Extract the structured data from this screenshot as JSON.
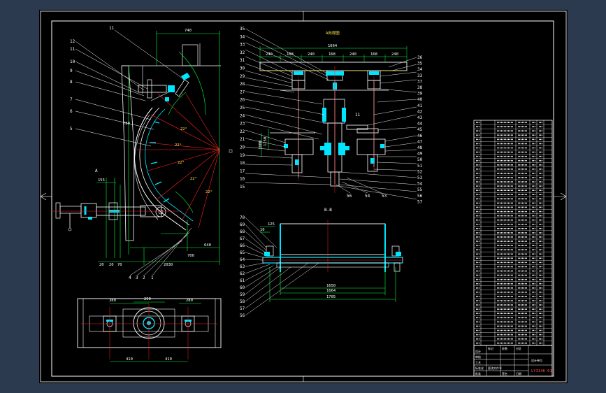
{
  "colors": {
    "background": "#2b3a4e",
    "sheet": "#000000",
    "outline": "#ffffff",
    "dimension": "#00ff3c",
    "part": "#00e5ff",
    "section": "#ff2020",
    "hidden": "#ffe34d"
  },
  "views": {
    "arc_view": {
      "section_mark": "A",
      "left_labels": [
        "11",
        "12",
        "11",
        "10",
        "9",
        "8",
        "7",
        "6",
        "5"
      ],
      "bottom_labels": [
        "4",
        "3",
        "2",
        "1"
      ],
      "dims": {
        "top_width": "740",
        "side_height": "780",
        "left_offset": "155",
        "lower_width": "640",
        "bottom_total": "2030",
        "bottom_small_a": "20",
        "bottom_small_b": "20",
        "bottom_small_c": "70",
        "right_height": "700"
      },
      "angles": [
        "22°",
        "22°",
        "22°",
        "22°",
        "22°"
      ]
    },
    "section_a": {
      "title": "A向视图",
      "top_dim": "1664",
      "segment_dims": [
        "240",
        "168",
        "240",
        "168",
        "240",
        "168",
        "240"
      ],
      "left_labels": [
        "35",
        "34",
        "33",
        "32",
        "31",
        "30",
        "29",
        "28",
        "27",
        "26",
        "25",
        "24",
        "23",
        "22",
        "21",
        "20",
        "19",
        "18",
        "17",
        "16",
        "15"
      ],
      "right_labels": [
        "36",
        "35",
        "34",
        "33",
        "37",
        "38",
        "39",
        "40",
        "41",
        "42",
        "43",
        "44",
        "45",
        "46",
        "47",
        "48",
        "49",
        "50",
        "51",
        "52",
        "53",
        "54",
        "55",
        "56",
        "57"
      ],
      "bottom_labels": [
        "56",
        "54",
        "53"
      ],
      "center_label": "11",
      "side_dim": "1000",
      "side_dim_b": "1150"
    },
    "section_b": {
      "title": "B-B",
      "left_labels": [
        "70",
        "69",
        "68",
        "67",
        "66",
        "65",
        "64",
        "63",
        "62",
        "61",
        "60",
        "59",
        "58",
        "57",
        "56"
      ],
      "dims": {
        "inner": "1650",
        "mid": "1664",
        "outer": "1705",
        "left_a": "125",
        "left_b": "10"
      }
    },
    "plan_view": {
      "dims": {
        "left": "380",
        "center": "290",
        "right": "280",
        "bottom_left": "410",
        "bottom_right": "410"
      }
    }
  },
  "title_block": {
    "drawing_number": "LY3146-01",
    "company": "设计单位",
    "rows": [
      "设计",
      "审核",
      "工艺",
      "标准化",
      "批准"
    ],
    "bottom_cells": [
      "标记",
      "处数",
      "分区",
      "更改文件号",
      "签名",
      "日期"
    ]
  }
}
